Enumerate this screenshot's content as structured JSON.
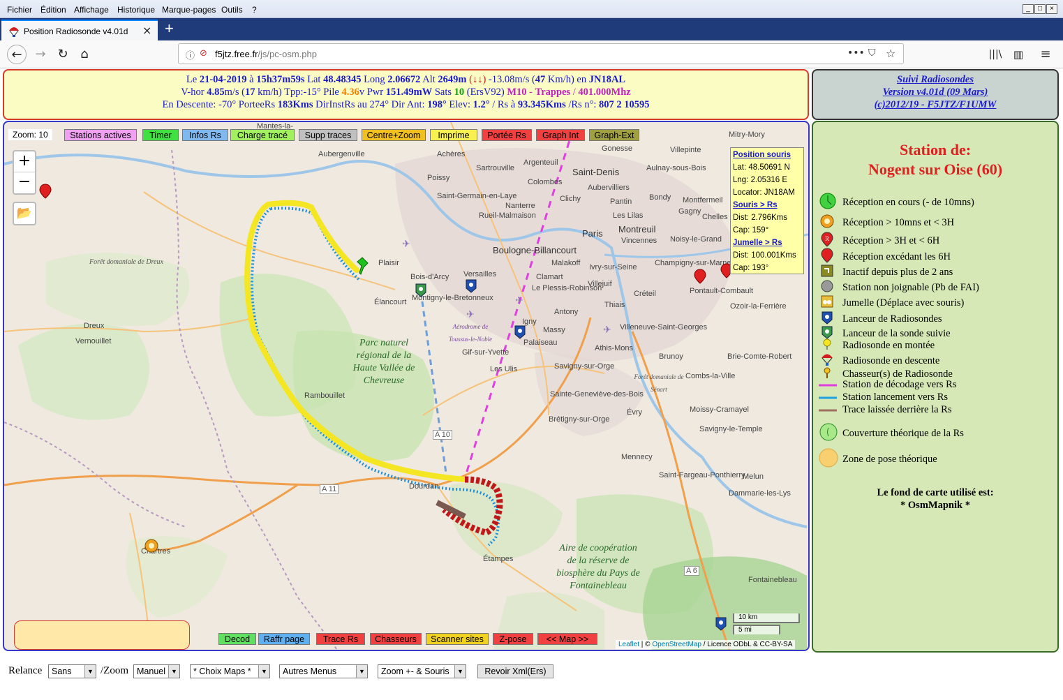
{
  "menu": [
    "Fichier",
    "Édition",
    "Affichage",
    "Historique",
    "Marque-pages",
    "Outils",
    "?"
  ],
  "tab": {
    "title": "Position Radiosonde v4.01d",
    "close": "×",
    "new": "+"
  },
  "url": {
    "host": "f5jtz.free.fr",
    "path": "/js/pc-osm.php"
  },
  "info": {
    "l1_pre": "Le ",
    "date": "21-04-2019",
    "l1_a": " à ",
    "time": "15h37m59s",
    "l1_b": " Lat ",
    "lat": "48.48345",
    "l1_c": " Long ",
    "lng": "2.06672",
    "l1_d": " Alt ",
    "alt": "2649m",
    "l1_e": " (↓↓) ",
    "vv": "-13.08",
    "l1_f": "m/s (",
    "kmh": "47",
    "l1_g": " Km/h) en ",
    "loc": "JN18AL",
    "l2_a": "V-hor ",
    "vhor": "4.85",
    "l2_b": "m/s (",
    "vhkm": "17",
    "l2_c": " km/h) Tpp:",
    "tpp": "-15°",
    "l2_d": " Pile ",
    "pile": "4.36",
    "l2_e": "v Pwr ",
    "pwr": "151.49mW",
    "l2_f": " Sats ",
    "sats": "10",
    "l2_g": " (ErsV92) ",
    "m10": "M10",
    "l2_h": " - ",
    "trappes": "Trappes",
    "l2_i": " / ",
    "freq": "401.000Mhz",
    "l3_a": "En Descente: ",
    "desc": "-70°",
    "l3_b": " PorteeRs ",
    "portee": "183Kms",
    "l3_c": " DirInstRs au ",
    "dir": "274°",
    "l3_d": " Dir Ant: ",
    "dirant": "198°",
    "l3_e": " Elev: ",
    "elev": "1.2°",
    "l3_f": " / Rs à ",
    "dist": "93.345Kms",
    "l3_g": " /Rs n°: ",
    "rsn": "807 2 10595"
  },
  "version": {
    "l1": "Suivi Radiosondes",
    "l2": "Version v4.01d (09 Mars)",
    "l3": "(c)2012/19 - F5JTZ/F1UMW"
  },
  "topbuttons": [
    {
      "label": "Stations actives",
      "color": "#f0a0f0"
    },
    {
      "label": "Timer",
      "color": "#40e040"
    },
    {
      "label": "Infos Rs",
      "color": "#80b8f0"
    },
    {
      "label": "Charge tracé",
      "color": "#a0f060"
    },
    {
      "label": "Supp traces",
      "color": "#c0c0c0"
    },
    {
      "label": "Centre+Zoom",
      "color": "#f0c020"
    },
    {
      "label": "Imprime",
      "color": "#f8f050"
    },
    {
      "label": "Portée Rs",
      "color": "#f04040"
    },
    {
      "label": "Graph Int",
      "color": "#f04040"
    },
    {
      "label": "Graph-Ext",
      "color": "#a0a040"
    }
  ],
  "bottombuttons": [
    {
      "label": "Decod",
      "color": "#60e060"
    },
    {
      "label": "Raffr page",
      "color": "#60b0f0"
    },
    {
      "label": "Trace Rs",
      "color": "#f04040"
    },
    {
      "label": "Chasseurs",
      "color": "#f04040"
    },
    {
      "label": "Scanner sites",
      "color": "#f0d020"
    },
    {
      "label": "Z-pose",
      "color": "#f04040"
    },
    {
      "label": "<< Map >>",
      "color": "#f04040"
    }
  ],
  "map": {
    "zoom_label": "Zoom: 10",
    "plus": "+",
    "minus": "−",
    "mouse": {
      "title": "Position souris",
      "lat": "Lat: 48.50691 N",
      "lng": "Lng: 2.05316 E",
      "loc": "Locator: JN18AM",
      "s2rs": "Souris > Rs",
      "d1": "Dist: 2.796Kms",
      "c1": "Cap: 159°",
      "jum": "Jumelle > Rs",
      "d2": "Dist: 100.001Kms",
      "c2": "Cap: 193°"
    },
    "scale_km": "10 km",
    "scale_mi": "5 mi",
    "attrib_leaflet": "Leaflet",
    "attrib_sep": " | © ",
    "attrib_osm": "OpenStreetMap",
    "attrib_rest": " / Licence ODbL & CC-BY-SA",
    "towns": [
      "Mantes-la-",
      "Aubergenville",
      "Achères",
      "Sartrouville",
      "Argenteuil",
      "Saint-Denis",
      "Villepinte",
      "Mitry-Mory",
      "Aulnay-sous-Bois",
      "Gonesse",
      "Poissy",
      "Colombes",
      "Aubervilliers",
      "Saint-Germain-en-Laye",
      "Nanterre",
      "Clichy",
      "Pantin",
      "Bondy",
      "Montfermeil",
      "Rueil-Malmaison",
      "Paris",
      "Les Lilas",
      "Montreuil",
      "Gagny",
      "Chelles",
      "Vincennes",
      "Noisy-le-Grand",
      "Boulogne-Billancourt",
      "Plaisir",
      "Malakoff",
      "Ivry-sur-Seine",
      "Champigny-sur-Marne",
      "Pontault-Combault",
      "Bois-d'Arcy",
      "Versailles",
      "Clamart",
      "Villejuif",
      "Le Plessis-Robinson",
      "Créteil",
      "Ozoir-la-Ferrière",
      "Élancourt",
      "Montigny-le-Bretonneux",
      "Thiais",
      "Antony",
      "Igny",
      "Massy",
      "Palaiseau",
      "Villeneuve-Saint-Georges",
      "Dreux",
      "Vernouillet",
      "Gif-sur-Yvette",
      "Les Ulis",
      "Athis-Mons",
      "Brunoy",
      "Brie-Comte-Robert",
      "Savigny-sur-Orge",
      "Combs-la-Ville",
      "Rambouillet",
      "Sainte-Geneviève-des-Bois",
      "Évry",
      "Moissy-Cramayel",
      "Brétigny-sur-Orge",
      "Savigny-le-Temple",
      "Mennecy",
      "Saint-Fargeau-Ponthierry",
      "Melun",
      "Dourdan",
      "Dammarie-les-Lys",
      "Étampes",
      "Fontainebleau",
      "Chartres"
    ],
    "parks": [
      "Forêt domaniale de Dreux",
      "Parc naturel régional de la Haute Vallée de Chevreuse",
      "Aérodrome de Toussus-le-Noble",
      "Forêt domaniale de Sénart",
      "Aire de coopération de la réserve de biosphère du Pays de Fontainebleau"
    ],
    "roads": [
      "A 10",
      "A 11",
      "A 6"
    ]
  },
  "legend": {
    "title1": "Station de:",
    "title2": "Nogent sur Oise (60)",
    "items": [
      {
        "icon": "green-marker-icon",
        "label": "Réception en cours (- de 10mns)"
      },
      {
        "icon": "orange-marker-icon",
        "label": "Réception > 10mns et < 3H"
      },
      {
        "icon": "red-r-marker-icon",
        "label": "Réception > 3H et < 6H"
      },
      {
        "icon": "red-marker-icon",
        "label": "Réception excédant les 6H"
      },
      {
        "icon": "olive-marker-icon",
        "label": "Inactif depuis plus de 2 ans"
      },
      {
        "icon": "grey-marker-icon",
        "label": "Station non joignable (Pb de FAI)"
      },
      {
        "icon": "binoculars-marker-icon",
        "label": "Jumelle (Déplace avec souris)"
      },
      {
        "icon": "launcher-icon",
        "label": "Lanceur de Radiosondes"
      },
      {
        "icon": "launcher-followed-icon",
        "label": "Lanceur de la sonde suivie"
      },
      {
        "icon": "balloon-up-icon",
        "label": "Radiosonde en montée"
      },
      {
        "icon": "parachute-icon",
        "label": "Radiosonde en descente"
      },
      {
        "icon": "chaser-icon",
        "label": "Chasseur(s) de Radiosonde"
      },
      {
        "icon": "magenta-line-icon",
        "label": "Station de décodage vers Rs"
      },
      {
        "icon": "cyan-line-icon",
        "label": "Station lancement vers Rs"
      },
      {
        "icon": "brown-line-icon",
        "label": "Trace laissée derrière la Rs"
      },
      {
        "icon": "coverage-icon",
        "label": "Couverture théorique de la Rs"
      },
      {
        "icon": "landing-zone-icon",
        "label": "Zone de pose théorique"
      }
    ],
    "footer1": "Le fond de carte utilisé est:",
    "footer2": "* OsmMapnik *"
  },
  "bottom": {
    "relance": "Relance",
    "relance_val": "Sans",
    "zoom": "/Zoom",
    "zoom_val": "Manuel",
    "maps": "* Choix Maps *",
    "menus": "Autres Menus",
    "zoomsouris": "Zoom +- & Souris",
    "revoir": "Revoir Xml(Ers)"
  }
}
